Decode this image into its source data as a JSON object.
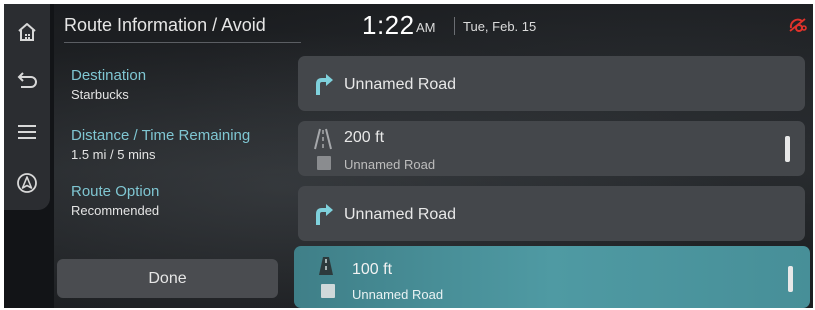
{
  "header": {
    "title": "Route Information / Avoid",
    "time": "1:22",
    "ampm": "AM",
    "date": "Tue, Feb. 15"
  },
  "rail": {
    "items": [
      "home-icon",
      "back-icon",
      "menu-icon",
      "navigation-icon"
    ]
  },
  "info": {
    "destination_label": "Destination",
    "destination_value": "Starbucks",
    "distance_label": "Distance / Time Remaining",
    "distance_value": "1.5 mi / 5 mins",
    "route_option_label": "Route Option",
    "route_option_value": "Recommended"
  },
  "done_label": "Done",
  "route_list": [
    {
      "icon": "turn-right-arrow-icon",
      "text": "Unnamed Road"
    },
    {
      "icon": "straight-road-icon",
      "distance": "200 ft",
      "road": "Unnamed Road"
    },
    {
      "icon": "turn-right-arrow-icon",
      "text": "Unnamed Road"
    },
    {
      "icon": "straight-road-icon",
      "distance": "100 ft",
      "road": "Unnamed Road",
      "selected": true
    }
  ],
  "colors": {
    "accent": "#7fc6d2",
    "highlight_row": "#4f9aa3",
    "status_icon": "#e0322b"
  }
}
